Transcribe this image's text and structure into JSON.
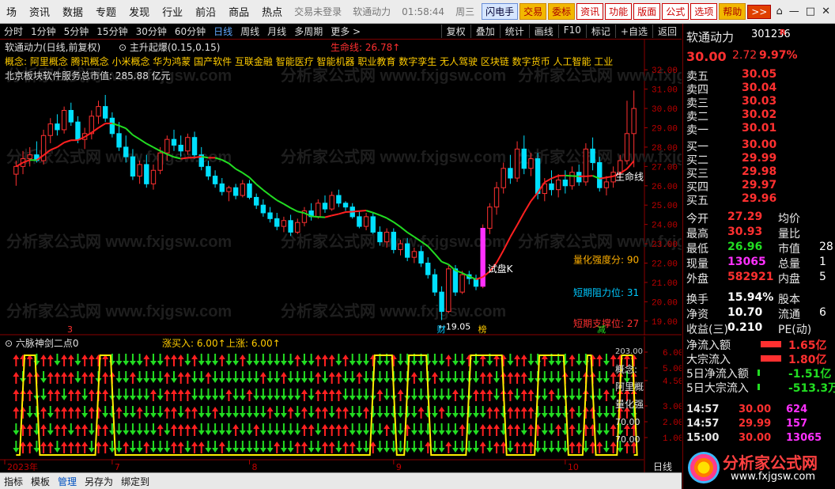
{
  "menubar": {
    "items": [
      "场",
      "资讯",
      "数据",
      "专题",
      "发现",
      "行业",
      "前沿",
      "商品",
      "热点"
    ],
    "status": [
      "交易未登录",
      "软通动力",
      "01:58:44",
      "周三"
    ],
    "buttons": [
      "闪电手",
      "交易",
      "委标",
      "资讯",
      "功能",
      "版面",
      "公式",
      "选项",
      "帮助",
      ">>"
    ]
  },
  "toolbar": {
    "periods": [
      "分时",
      "1分钟",
      "5分钟",
      "15分钟",
      "30分钟",
      "60分钟",
      "日线",
      "周线",
      "月线",
      "多周期",
      "更多 >"
    ],
    "active": "日线",
    "right": [
      "复权",
      "叠加",
      "统计",
      "画线",
      "F10",
      "标记",
      "+自选",
      "返回"
    ]
  },
  "main": {
    "title": "软通动力(日线,前复权)",
    "formula": "主升起爆(0.15,0.15)",
    "lifeline_label": "生命线: 26.78↑",
    "concept_line": "概念:  阿里概念 腾讯概念 小米概念 华为鸿蒙 国产软件 互联金融 智能医疗 智能机器 职业教育 数字孪生 无人驾驶 区块链 数字货币 人工智能 工业",
    "sector_line": "北京板块软件服务总市值:  285.88 亿元",
    "watermark": "分析家公式网 www.fxjgsw.com",
    "annotations": {
      "shipan": "试盘K",
      "low": "←19.05",
      "lifeline_right": "生命线",
      "strength": "量化强度分:  90",
      "resist": "短期阻力位:  31",
      "support": "短期支撑位:  27"
    },
    "markers": {
      "m1": "3",
      "m2": "财",
      "m3": "榜",
      "m4": "减"
    },
    "yaxis": [
      "32.00",
      "31.00",
      "30.00",
      "29.00",
      "28.00",
      "27.00",
      "26.00",
      "25.00",
      "24.00",
      "23.00",
      "22.00",
      "21.00",
      "20.00",
      "19.00"
    ],
    "lifeline_green": "#22dd22",
    "lifeline_red": "#ff2020",
    "up_color": "#ff3030",
    "down_color": "#00e0ff"
  },
  "indicator": {
    "title": "六脉神剑二点0",
    "buy_label": "涨买入: 6.00↑",
    "rise_label": "上涨: 6.00↑",
    "right_labels": [
      "概念:",
      "阿里概",
      "量化强",
      "70.00",
      "70.00"
    ],
    "yaxis": [
      "6.00",
      "5.00",
      "4.50",
      "3.00",
      "2.00",
      "1.00"
    ],
    "top_tick": "203.00"
  },
  "xaxis": {
    "labels": [
      "2023年",
      "7",
      "8",
      "9",
      "10"
    ],
    "corner": "日线"
  },
  "right": {
    "stock_name": "软通动力",
    "stock_code": "301236",
    "code_flag": "R",
    "price": "30.00",
    "change": "2.72",
    "pct": "9.97%",
    "asks": [
      [
        "卖五",
        "30.05"
      ],
      [
        "卖四",
        "30.04"
      ],
      [
        "卖三",
        "30.03"
      ],
      [
        "卖二",
        "30.02"
      ],
      [
        "卖一",
        "30.01"
      ]
    ],
    "bids": [
      [
        "买一",
        "30.00"
      ],
      [
        "买二",
        "29.99"
      ],
      [
        "买三",
        "29.98"
      ],
      [
        "买四",
        "29.97"
      ],
      [
        "买五",
        "29.96"
      ]
    ],
    "stats": [
      [
        "今开",
        "27.29",
        "均价",
        ""
      ],
      [
        "最高",
        "30.93",
        "量比",
        ""
      ],
      [
        "最低",
        "26.96",
        "市值",
        "28"
      ],
      [
        "现量",
        "13065",
        "总量",
        "1"
      ],
      [
        "外盘",
        "582921",
        "内盘",
        "5"
      ],
      [
        "换手",
        "15.94%",
        "股本",
        ""
      ],
      [
        "净资",
        "10.70",
        "流通",
        "6"
      ],
      [
        "收益(三)",
        "0.210",
        "PE(动)",
        ""
      ]
    ],
    "flows": [
      [
        "净流入额",
        "1.65亿"
      ],
      [
        "大宗流入",
        "1.80亿"
      ],
      [
        "5日净流入额",
        "-1.51亿"
      ],
      [
        "5日大宗流入",
        "-513.3万"
      ]
    ],
    "ticks": [
      [
        "14:57",
        "30.00",
        "624"
      ],
      [
        "14:57",
        "29.99",
        "157"
      ],
      [
        "15:00",
        "30.00",
        "13065"
      ]
    ],
    "logo_text": "分析家公式网",
    "logo_url": "www.fxjgsw.com"
  },
  "bottombar": {
    "tabs": [
      "指标",
      "模板",
      "管理",
      "另存为",
      "绑定到"
    ],
    "active": "管理"
  },
  "chart_data": {
    "type": "candlestick",
    "title": "软通动力(日线,前复权)",
    "ylim": [
      18.5,
      32.5
    ],
    "candles": [
      [
        26.6,
        27.3,
        26.0,
        27.0
      ],
      [
        27.0,
        27.8,
        26.6,
        27.4
      ],
      [
        27.4,
        28.0,
        27.0,
        27.6
      ],
      [
        27.6,
        28.3,
        27.2,
        27.3
      ],
      [
        27.3,
        28.9,
        27.1,
        28.6
      ],
      [
        28.6,
        29.5,
        28.2,
        29.2
      ],
      [
        29.2,
        29.7,
        28.6,
        28.9
      ],
      [
        28.9,
        30.1,
        28.7,
        29.9
      ],
      [
        29.9,
        30.3,
        29.1,
        29.3
      ],
      [
        29.3,
        29.6,
        28.2,
        28.4
      ],
      [
        28.4,
        29.0,
        27.9,
        28.7
      ],
      [
        28.7,
        29.9,
        28.4,
        29.6
      ],
      [
        29.6,
        30.4,
        29.2,
        30.1
      ],
      [
        30.1,
        30.7,
        29.3,
        29.5
      ],
      [
        29.5,
        29.8,
        28.5,
        28.7
      ],
      [
        28.7,
        29.3,
        27.8,
        28.0
      ],
      [
        28.0,
        28.6,
        27.2,
        27.5
      ],
      [
        27.5,
        27.9,
        26.3,
        26.5
      ],
      [
        26.5,
        27.3,
        26.1,
        27.1
      ],
      [
        27.1,
        27.6,
        25.9,
        26.1
      ],
      [
        26.1,
        27.1,
        25.8,
        26.8
      ],
      [
        26.8,
        28.0,
        26.6,
        27.7
      ],
      [
        27.7,
        28.6,
        27.3,
        28.4
      ],
      [
        28.4,
        28.9,
        27.8,
        28.1
      ],
      [
        28.1,
        28.6,
        27.5,
        27.8
      ],
      [
        27.8,
        28.7,
        27.6,
        28.5
      ],
      [
        28.5,
        28.8,
        27.4,
        27.6
      ],
      [
        27.6,
        28.0,
        26.8,
        27.0
      ],
      [
        27.0,
        27.3,
        26.3,
        26.5
      ],
      [
        26.5,
        26.8,
        25.9,
        26.1
      ],
      [
        26.1,
        26.4,
        25.5,
        25.7
      ],
      [
        25.7,
        26.0,
        25.2,
        25.9
      ],
      [
        25.9,
        26.1,
        25.3,
        25.5
      ],
      [
        25.5,
        26.3,
        25.4,
        26.1
      ],
      [
        26.1,
        26.3,
        25.3,
        25.4
      ],
      [
        25.4,
        25.6,
        24.8,
        25.0
      ],
      [
        25.0,
        25.3,
        24.4,
        24.6
      ],
      [
        24.6,
        24.9,
        24.1,
        24.3
      ],
      [
        24.3,
        24.6,
        23.7,
        23.9
      ],
      [
        23.9,
        24.4,
        23.6,
        24.2
      ],
      [
        24.2,
        24.5,
        23.4,
        23.6
      ],
      [
        23.6,
        24.3,
        23.5,
        24.1
      ],
      [
        24.1,
        24.9,
        23.9,
        24.7
      ],
      [
        24.7,
        25.1,
        24.2,
        24.4
      ],
      [
        24.4,
        25.3,
        24.3,
        25.1
      ],
      [
        25.1,
        25.5,
        24.6,
        24.8
      ],
      [
        24.8,
        25.7,
        24.7,
        25.5
      ],
      [
        25.5,
        25.8,
        24.9,
        25.1
      ],
      [
        25.1,
        25.2,
        24.7,
        24.9
      ],
      [
        24.9,
        25.1,
        24.3,
        24.4
      ],
      [
        24.4,
        24.7,
        23.8,
        23.9
      ],
      [
        23.9,
        24.6,
        23.7,
        24.4
      ],
      [
        24.4,
        24.6,
        23.5,
        23.6
      ],
      [
        23.6,
        23.9,
        22.9,
        23.1
      ],
      [
        23.1,
        23.8,
        22.8,
        23.6
      ],
      [
        23.6,
        23.8,
        22.5,
        22.7
      ],
      [
        22.7,
        23.2,
        22.4,
        23.0
      ],
      [
        23.0,
        23.3,
        22.1,
        22.3
      ],
      [
        22.3,
        22.8,
        22.0,
        22.6
      ],
      [
        22.6,
        22.9,
        21.8,
        22.0
      ],
      [
        22.0,
        22.3,
        21.2,
        21.4
      ],
      [
        21.4,
        21.7,
        20.3,
        20.5
      ],
      [
        20.5,
        20.8,
        19.05,
        19.5
      ],
      [
        19.5,
        21.9,
        19.4,
        21.7
      ],
      [
        21.7,
        21.9,
        20.3,
        20.5
      ],
      [
        20.5,
        21.6,
        20.4,
        21.4
      ],
      [
        21.4,
        21.6,
        20.9,
        21.2
      ],
      [
        21.2,
        21.4,
        20.6,
        20.8
      ],
      [
        20.8,
        24.0,
        20.7,
        23.8
      ],
      [
        23.8,
        25.1,
        23.5,
        24.9
      ],
      [
        24.9,
        26.2,
        24.5,
        25.9
      ],
      [
        25.9,
        27.2,
        25.6,
        26.9
      ],
      [
        26.9,
        27.6,
        26.1,
        26.4
      ],
      [
        26.4,
        28.3,
        26.2,
        27.9
      ],
      [
        27.9,
        28.6,
        26.6,
        26.9
      ],
      [
        26.9,
        27.7,
        26.5,
        27.4
      ],
      [
        27.4,
        27.7,
        25.3,
        25.6
      ],
      [
        25.6,
        26.4,
        25.2,
        26.1
      ],
      [
        26.1,
        26.8,
        25.5,
        25.8
      ],
      [
        25.8,
        26.6,
        25.4,
        26.3
      ],
      [
        26.3,
        26.8,
        25.6,
        26.0
      ],
      [
        26.0,
        27.0,
        25.8,
        26.7
      ],
      [
        26.7,
        27.1,
        26.0,
        26.2
      ],
      [
        26.2,
        28.2,
        26.0,
        27.9
      ],
      [
        27.9,
        28.5,
        26.8,
        27.2
      ],
      [
        27.2,
        27.5,
        25.7,
        25.9
      ],
      [
        25.9,
        26.5,
        25.5,
        26.2
      ],
      [
        26.2,
        27.0,
        25.9,
        26.7
      ],
      [
        26.7,
        27.6,
        26.4,
        27.3
      ],
      [
        27.3,
        30.4,
        27.1,
        28.7
      ],
      [
        28.7,
        30.93,
        26.96,
        30.0
      ]
    ]
  }
}
